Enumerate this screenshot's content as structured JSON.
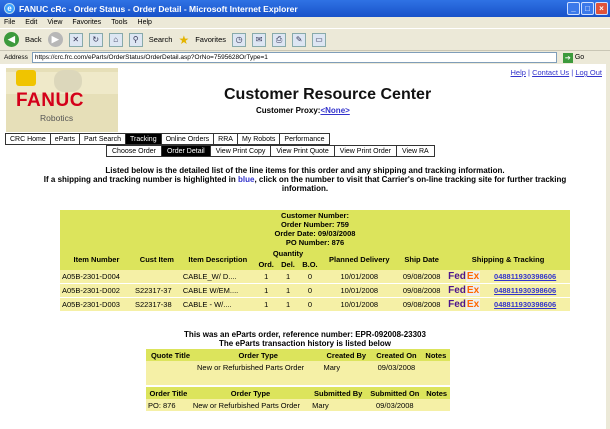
{
  "browser": {
    "title": "FANUC cRc - Order Status - Order Detail - Microsoft Internet Explorer",
    "menu": [
      "File",
      "Edit",
      "View",
      "Favorites",
      "Tools",
      "Help"
    ],
    "toolbar": {
      "back": "Back",
      "search": "Search",
      "favorites": "Favorites"
    },
    "address_label": "Address",
    "address_url": "https://crc.frc.com/eParts/OrderStatus/OrderDetail.asp?OrNo=7595628OrType=1",
    "go_label": "Go"
  },
  "header": {
    "logo_brand": "FANUC",
    "logo_sub": "Robotics",
    "title": "Customer Resource Center",
    "proxy_label": "Customer Proxy:",
    "proxy_value": "<None>",
    "help_link": "Help",
    "contact_link": "Contact Us",
    "logout_link": "Log Out"
  },
  "tabs_primary": [
    {
      "label": "CRC Home",
      "active": false
    },
    {
      "label": "eParts",
      "active": false
    },
    {
      "label": "Part Search",
      "active": false
    },
    {
      "label": "Tracking",
      "active": true
    },
    {
      "label": "Online Orders",
      "active": false
    },
    {
      "label": "RRA",
      "active": false
    },
    {
      "label": "My Robots",
      "active": false
    },
    {
      "label": "Performance",
      "active": false
    }
  ],
  "tabs_secondary": [
    {
      "label": "Choose Order",
      "active": false
    },
    {
      "label": "Order Detail",
      "active": true
    },
    {
      "label": "View Print Copy",
      "active": false
    },
    {
      "label": "View Print Quote",
      "active": false
    },
    {
      "label": "View Print Order",
      "active": false
    },
    {
      "label": "View RA",
      "active": false
    }
  ],
  "info": {
    "line1": "Listed below is the detailed list of the line items for this order and any shipping and tracking information.",
    "line2_pre": "If a shipping and tracking number is highlighted in ",
    "line2_blue": "blue",
    "line2_post": ", click on the number to visit that Carrier's on-line tracking site for further tracking",
    "line3": "information."
  },
  "order": {
    "customer_number": "Customer Number:",
    "order_number": "Order Number: 759",
    "order_date": "Order Date: 09/03/2008",
    "po_number": "PO Number: 876"
  },
  "table_headers": {
    "item_number": "Item Number",
    "cust_item": "Cust Item",
    "item_description": "Item Description",
    "quantity": "Quantity",
    "ord": "Ord.",
    "del": "Del.",
    "bo": "B.O.",
    "planned_delivery": "Planned Delivery",
    "ship_date": "Ship Date",
    "shipping_tracking": "Shipping & Tracking"
  },
  "line_items": [
    {
      "item": "A05B-2301-D004",
      "cust_item": "",
      "desc": "CABLE_W/ D....",
      "ord": "1",
      "del": "1",
      "bo": "0",
      "planned": "10/01/2008",
      "ship": "09/08/2008",
      "carrier": "FedEx",
      "tracking": "048811930398606"
    },
    {
      "item": "A05B-2301-D002",
      "cust_item": "S22317-37",
      "desc": "CABLE W/EM....",
      "ord": "1",
      "del": "1",
      "bo": "0",
      "planned": "10/01/2008",
      "ship": "09/08/2008",
      "carrier": "FedEx",
      "tracking": "048811930398606"
    },
    {
      "item": "A05B-2301-D003",
      "cust_item": "S22317-38",
      "desc": "CABLE - W/....",
      "ord": "1",
      "del": "1",
      "bo": "0",
      "planned": "10/01/2008",
      "ship": "09/08/2008",
      "carrier": "FedEx",
      "tracking": "048811930398606"
    }
  ],
  "eparts": {
    "line1": "This was an eParts order, reference number: EPR-092008-23303",
    "line2": "The eParts transaction history is listed below"
  },
  "quote_table": {
    "headers": [
      "Quote Title",
      "Order Type",
      "Created By",
      "Created On",
      "Notes"
    ],
    "row": [
      "",
      "New or Refurbished Parts Order",
      "Mary",
      "09/03/2008",
      ""
    ]
  },
  "order_table": {
    "headers": [
      "Order Title",
      "Order Type",
      "Submitted By",
      "Submitted On",
      "Notes"
    ],
    "row": [
      "PO: 876",
      "New or Refurbished Parts Order",
      "Mary",
      "09/03/2008",
      ""
    ]
  },
  "colors": {
    "header_green": "#dce45c",
    "row_yellow": "#f5f0a6",
    "link_blue": "#3333cc",
    "brand_red": "#d4001a"
  }
}
